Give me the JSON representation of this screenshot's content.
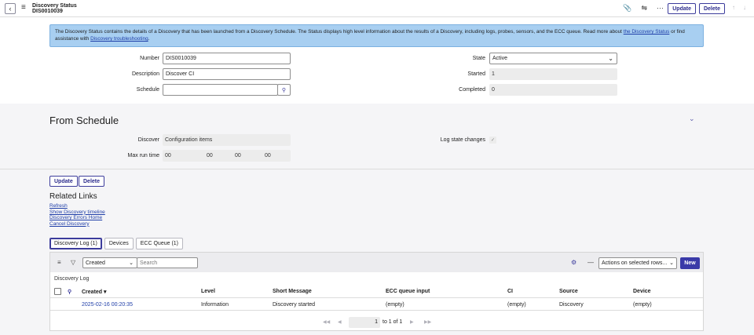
{
  "header": {
    "title": "Discovery Status",
    "record_id": "DIS0010039",
    "update_label": "Update",
    "delete_label": "Delete",
    "more_label": "···"
  },
  "info": {
    "text": "The Discovery Status contains the details of a Discovery that has been launched from a Discovery Schedule. The Status displays high level information about the results of a Discovery, including logs, probes, sensors, and the ECC queue. Read more about ",
    "link1": "the Discovery Status",
    "mid": " or find assistance with ",
    "link2": "Discovery troubleshooting",
    "end": "."
  },
  "form": {
    "number_label": "Number",
    "number_value": "DIS0010039",
    "description_label": "Description",
    "description_value": "Discover CI",
    "schedule_label": "Schedule",
    "schedule_value": "",
    "state_label": "State",
    "state_value": "Active",
    "started_label": "Started",
    "started_value": "1",
    "completed_label": "Completed",
    "completed_value": "0"
  },
  "from_schedule": {
    "title": "From Schedule",
    "discover_label": "Discover",
    "discover_value": "Configuration items",
    "max_run_label": "Max run time",
    "max_run_values": [
      "00",
      "00",
      "00",
      "00"
    ],
    "log_state_label": "Log state changes",
    "log_state_checked": true
  },
  "actions": {
    "update_label": "Update",
    "delete_label": "Delete"
  },
  "related_links": {
    "title": "Related Links",
    "links": [
      "Refresh",
      "Show Discovery timeline",
      "Discovery Errors Home",
      "Cancel Discovery"
    ]
  },
  "tabs": [
    {
      "label": "Discovery Log (1)",
      "active": true
    },
    {
      "label": "Devices",
      "active": false
    },
    {
      "label": "ECC Queue (1)",
      "active": false
    }
  ],
  "list": {
    "filter_field": "Created",
    "search_placeholder": "Search",
    "actions_label": "Actions on selected rows...",
    "new_label": "New",
    "caption": "Discovery Log",
    "columns": [
      "Created ▾",
      "Level",
      "Short Message",
      "ECC queue input",
      "CI",
      "Source",
      "Device"
    ],
    "rows": [
      [
        "2025-02-16 00:20:35",
        "Information",
        "Discovery started",
        "(empty)",
        "(empty)",
        "Discovery",
        "(empty)"
      ]
    ],
    "pager_page": "1",
    "pager_text": "to 1 of 1"
  }
}
